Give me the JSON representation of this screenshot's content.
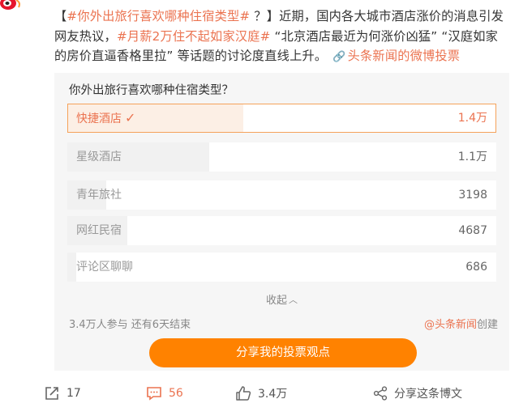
{
  "post": {
    "open_bracket": "【",
    "topic_tag": "#你外出旅行喜欢哪种住宿类型#",
    "text_1": " ？】近期，国内各大城市酒店涨价的消息引发网友热议，",
    "topic_tag_2": "#月薪2万住不起如家汉庭#",
    "text_2": " “北京酒店最近为何涨价凶猛” “汉庭如家的房价直逼香格里拉” 等话题的讨论度直线上升。",
    "link_text": "头条新闻的微博投票"
  },
  "vote": {
    "question": "你外出旅行喜欢哪种住宿类型？",
    "options": [
      {
        "label": "快捷酒店",
        "count": "1.4万",
        "share": 0.41,
        "selected": true
      },
      {
        "label": "星级酒店",
        "count": "1.1万",
        "share": 0.33,
        "selected": false
      },
      {
        "label": "青年旅社",
        "count": "3198",
        "share": 0.09,
        "selected": false
      },
      {
        "label": "网红民宿",
        "count": "4687",
        "share": 0.14,
        "selected": false
      },
      {
        "label": "评论区聊聊",
        "count": "686",
        "share": 0.02,
        "selected": false
      }
    ],
    "collapse_label": "收起",
    "stats": "3.4万人参与  还有6天结束",
    "creator_name": "@头条新闻",
    "creator_suffix": "创建",
    "share_button": "分享我的投票观点"
  },
  "actions": {
    "repost_count": "17",
    "comment_count": "56",
    "like_count": "3.4万",
    "share_label": "分享这条博文"
  },
  "colors": {
    "accent": "#eb7350",
    "button": "#ff8200",
    "card_bg": "#f6f6f6",
    "selected_border": "#f5a25a"
  },
  "icons": {
    "logo": "weibo-logo-icon",
    "link": "link-chain-icon",
    "check": "check-icon",
    "collapse": "chevron-up-icon",
    "repost": "repost-icon",
    "comment": "comment-icon",
    "like": "thumbs-up-icon",
    "share": "share-nodes-icon"
  }
}
